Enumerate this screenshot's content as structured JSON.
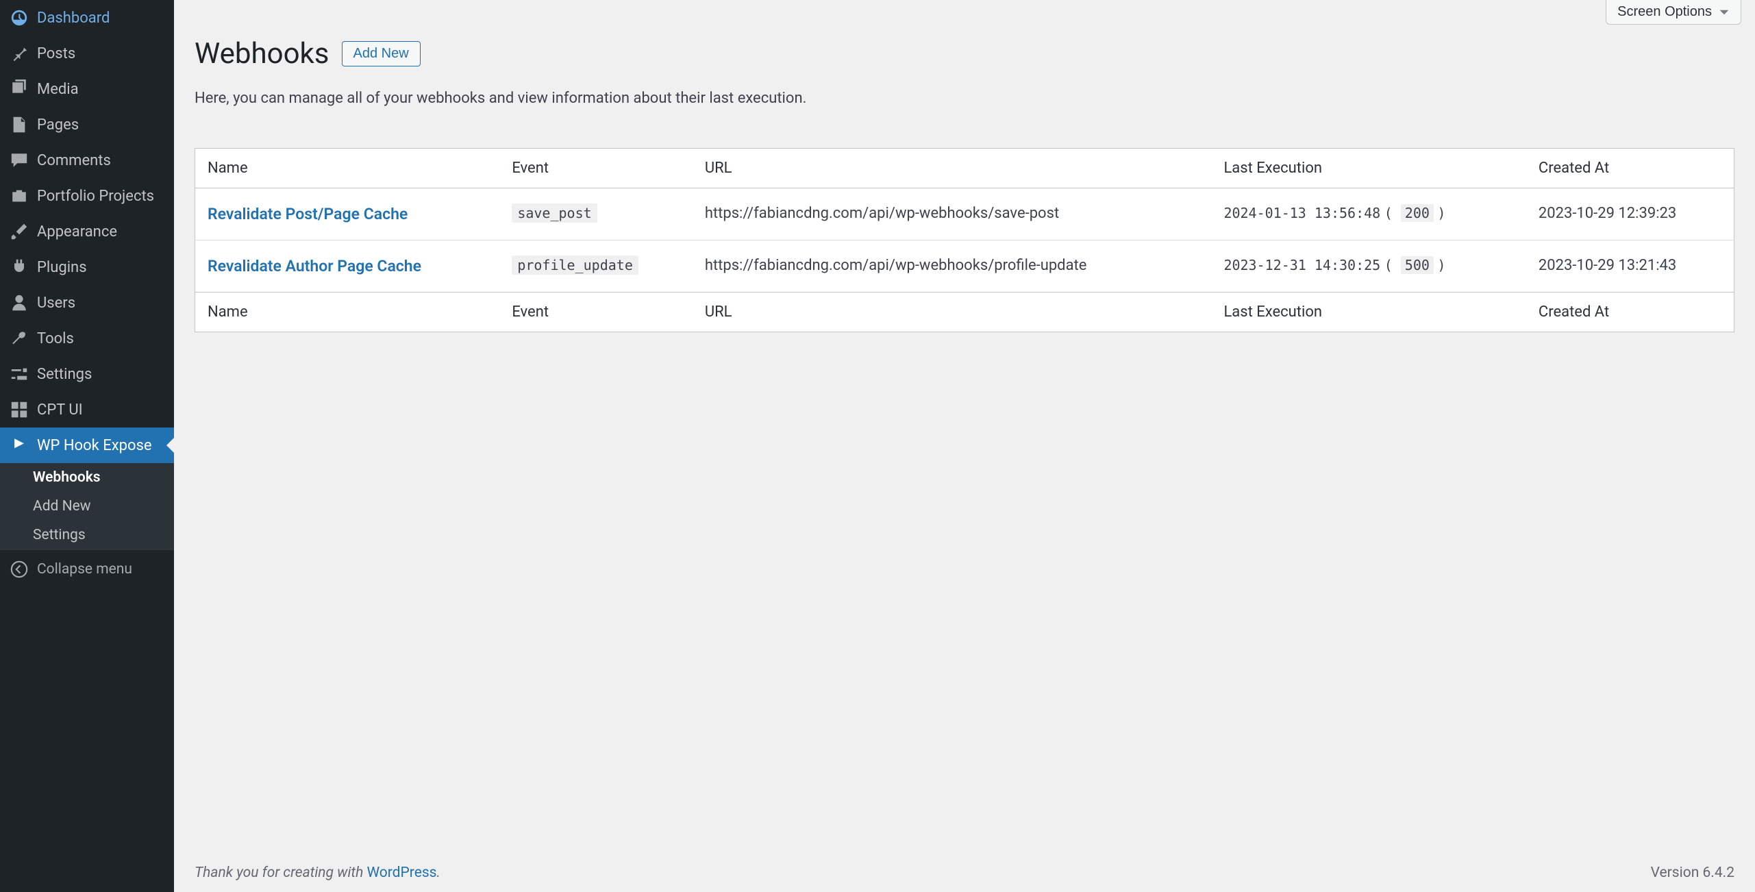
{
  "sidebar": {
    "items": [
      {
        "label": "Dashboard"
      },
      {
        "label": "Posts"
      },
      {
        "label": "Media"
      },
      {
        "label": "Pages"
      },
      {
        "label": "Comments"
      },
      {
        "label": "Portfolio Projects"
      },
      {
        "label": "Appearance"
      },
      {
        "label": "Plugins"
      },
      {
        "label": "Users"
      },
      {
        "label": "Tools"
      },
      {
        "label": "Settings"
      },
      {
        "label": "CPT UI"
      },
      {
        "label": "WP Hook Expose"
      }
    ],
    "submenu": {
      "items": [
        {
          "label": "Webhooks"
        },
        {
          "label": "Add New"
        },
        {
          "label": "Settings"
        }
      ]
    },
    "collapse_label": "Collapse menu"
  },
  "screen_options_label": "Screen Options",
  "page": {
    "title": "Webhooks",
    "add_new_label": "Add New",
    "description": "Here, you can manage all of your webhooks and view information about their last execution."
  },
  "table": {
    "headers": {
      "name": "Name",
      "event": "Event",
      "url": "URL",
      "last_execution": "Last Execution",
      "created_at": "Created At"
    },
    "rows": [
      {
        "name": "Revalidate Post/Page Cache",
        "event": "save_post",
        "url": "https://fabiancdng.com/api/wp-webhooks/save-post",
        "last_execution_time": "2024-01-13 13:56:48",
        "last_execution_status": "200",
        "created_at": "2023-10-29 12:39:23"
      },
      {
        "name": "Revalidate Author Page Cache",
        "event": "profile_update",
        "url": "https://fabiancdng.com/api/wp-webhooks/profile-update",
        "last_execution_time": "2023-12-31 14:30:25",
        "last_execution_status": "500",
        "created_at": "2023-10-29 13:21:43"
      }
    ]
  },
  "footer": {
    "thanks_prefix": "Thank you for creating with ",
    "thanks_link": "WordPress",
    "thanks_suffix": ".",
    "version_label": "Version 6.4.2"
  }
}
